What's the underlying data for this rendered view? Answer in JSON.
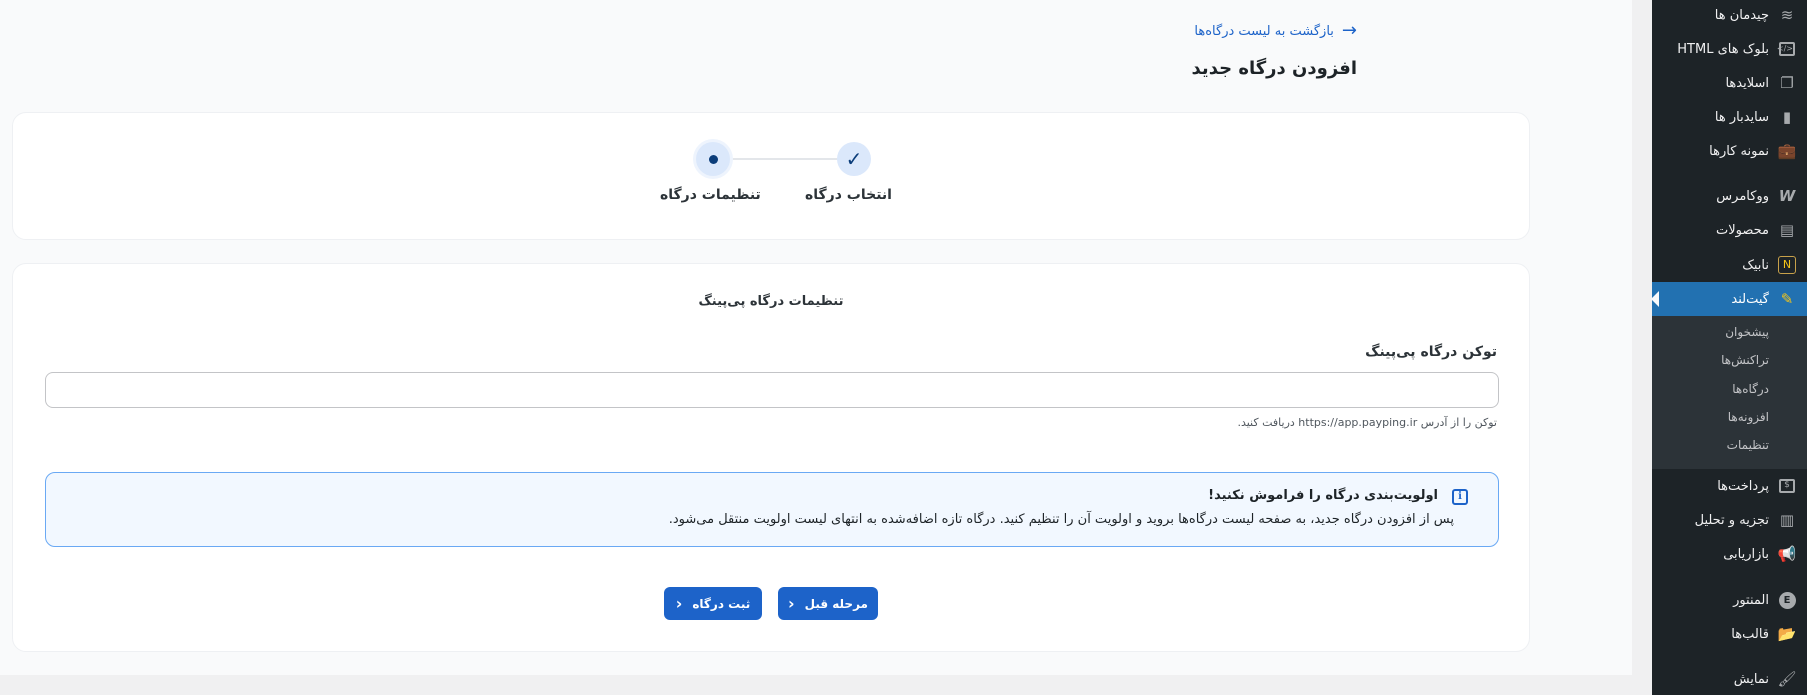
{
  "header": {
    "back_link": "بازگشت به لیست درگاه‌ها",
    "page_title": "افزودن درگاه جدید"
  },
  "stepper": {
    "steps": [
      {
        "label": "انتخاب درگاه",
        "status": "done"
      },
      {
        "label": "تنظیمات درگاه",
        "status": "current"
      }
    ]
  },
  "form": {
    "section_title": "تنظیمات درگاه پی‌پینگ",
    "token_label": "توکن درگاه پی‌پینگ",
    "token_value": "",
    "token_help": "توکن را از آدرس https://app.payping.ir دریافت کنید."
  },
  "notice": {
    "title": "اولویت‌بندی درگاه را فراموش نکنید!",
    "text": "پس از افزودن درگاه جدید، به صفحه لیست درگاه‌ها بروید و اولویت آن را تنظیم کنید. درگاه تازه اضافه‌شده به انتهای لیست اولویت منتقل می‌شود."
  },
  "buttons": {
    "prev": "مرحله قبل",
    "submit": "ثبت درگاه"
  },
  "sidebar": {
    "items": [
      {
        "label": "چیدمان ها",
        "icon": "layers-icon"
      },
      {
        "label": "بلوک های HTML",
        "icon": "code-block-icon"
      },
      {
        "label": "اسلایدها",
        "icon": "slides-icon"
      },
      {
        "label": "سایدبار ها",
        "icon": "sidebar-icon"
      },
      {
        "label": "نمونه کارها",
        "icon": "briefcase-icon"
      },
      {
        "label": "ووکامرس",
        "icon": "woocommerce-icon"
      },
      {
        "label": "محصولات",
        "icon": "archive-icon"
      },
      {
        "label": "نابیک",
        "icon": "nabik-icon"
      },
      {
        "label": "گیت‌لند",
        "icon": "gateland-icon"
      },
      {
        "label": "پرداخت‌ها",
        "icon": "dollar-icon"
      },
      {
        "label": "تجزیه و تحلیل",
        "icon": "bar-chart-icon"
      },
      {
        "label": "بازاریابی",
        "icon": "megaphone-icon"
      },
      {
        "label": "المنتور",
        "icon": "elementor-icon"
      },
      {
        "label": "قالب‌ها",
        "icon": "folder-icon"
      },
      {
        "label": "نمایش",
        "icon": "brush-icon"
      }
    ],
    "submenu": [
      {
        "label": "پیشخوان"
      },
      {
        "label": "تراکنش‌ها"
      },
      {
        "label": "درگاه‌ها"
      },
      {
        "label": "افزونه‌ها"
      },
      {
        "label": "تنظیمات"
      }
    ]
  },
  "colors": {
    "accent": "#1d63c9",
    "sidebar_bg": "#1d2327",
    "sidebar_active": "#2271b1",
    "notice_border": "#6aa9f4"
  }
}
